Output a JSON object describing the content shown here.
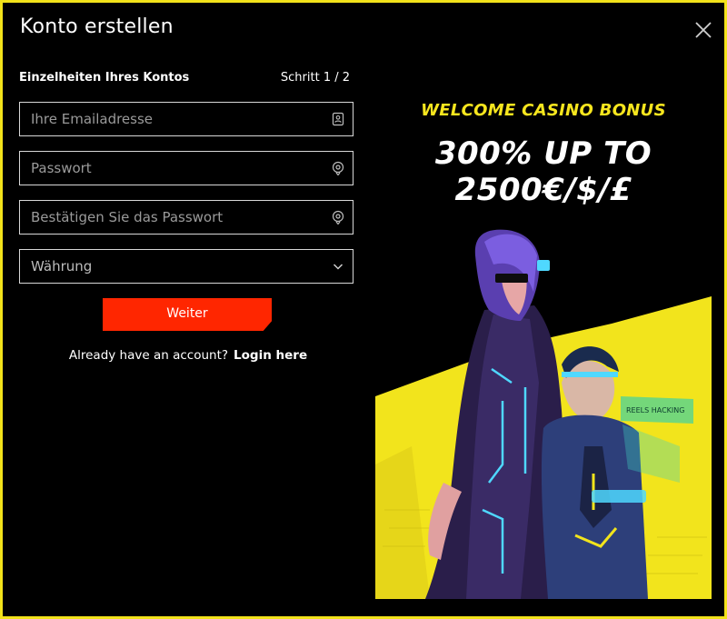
{
  "dialog": {
    "title": "Konto erstellen",
    "close_icon": "close-icon"
  },
  "form": {
    "section_label": "Einzelheiten Ihres Kontos",
    "step": "Schritt 1 / 2",
    "email_placeholder": "Ihre Emailadresse",
    "email_icon": "contact-card-icon",
    "password_placeholder": "Passwort",
    "password_icon": "eye-icon",
    "confirm_placeholder": "Bestätigen Sie das Passwort",
    "confirm_icon": "eye-icon",
    "currency_label": "Währung",
    "currency_icon": "chevron-down-icon",
    "submit_label": "Weiter",
    "account_prompt": "Already have an account?",
    "login_link": "Login here"
  },
  "promo": {
    "subtitle": "WELCOME CASINO BONUS",
    "headline_line1": "300% UP TO",
    "headline_line2": "2500€/$/£",
    "sign_text": "REELS HACKING"
  },
  "colors": {
    "border": "#f2e21a",
    "accent_yellow": "#f7e61e",
    "button_red": "#ff2600",
    "background": "#000000"
  }
}
